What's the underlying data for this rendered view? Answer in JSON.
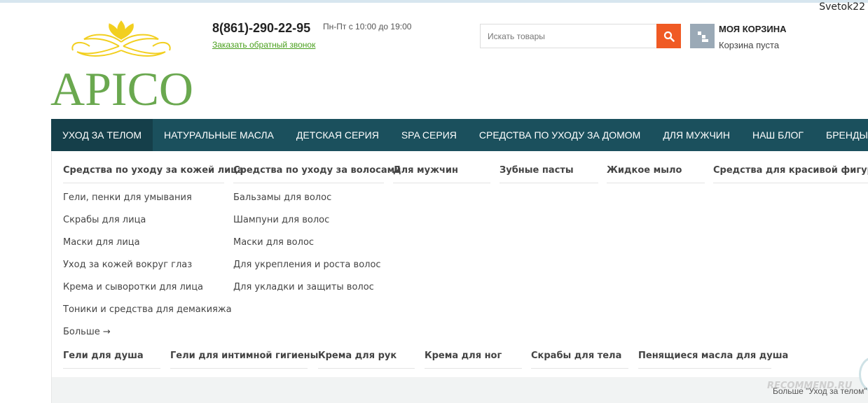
{
  "user": {
    "name": "Svetok22"
  },
  "logo": {
    "text": "APICO"
  },
  "contact": {
    "phone": "8(861)-290-22-95",
    "hours": "Пн-Пт с 10:00 до 19:00",
    "callback": "Заказать обратный звонок"
  },
  "search": {
    "placeholder": "Искать товары",
    "value": ""
  },
  "cart": {
    "title": "МОЯ КОРЗИНА",
    "status": "Корзина пуста"
  },
  "nav": [
    "УХОД ЗА ТЕЛОМ",
    "НАТУРАЛЬНЫЕ МАСЛА",
    "ДЕТСКАЯ СЕРИЯ",
    "SPA СЕРИЯ",
    "СРЕДСТВА ПО УХОДУ ЗА ДОМОМ",
    "ДЛЯ МУЖЧИН",
    "НАШ БЛОГ",
    "БРЕНДЫ"
  ],
  "mega": {
    "row1": [
      "Средства по уходу за кожей лица",
      "Средства по уходу за волосами",
      "Для мужчин",
      "Зубные пасты",
      "Жидкое мыло",
      "Средства для красивой фигуры."
    ],
    "face_items": [
      "Гели, пенки для умывания",
      "Скрабы для лица",
      "Маски для лица",
      "Уход за кожей вокруг глаз",
      "Крема и сыворотки для лица",
      "Тоники и средства для демакияжа",
      "Больше →"
    ],
    "hair_items": [
      "Бальзамы для волос",
      "Шампуни для волос",
      "Маски для волос",
      "Для укрепления и роста волос",
      "Для укладки и защиты волос"
    ],
    "row2": [
      "Гели для душа",
      "Гели для интимной гигиены",
      "Крема для рук",
      "Крема для ног",
      "Скрабы для тела",
      "Пенящиеся масла для душа"
    ]
  },
  "footer": {
    "overflow": "Больше \"Уход за телом\""
  },
  "watermark": {
    "text": "RECOMMEND.RU"
  },
  "colors": {
    "nav_bg": "#1b505d",
    "nav_active": "#153f4a",
    "search_button": "#f05a24",
    "link_green": "#4aa01e",
    "logo_green": "#6aa84f",
    "logo_gold": "#f2cf1f"
  },
  "icons": {
    "search": "search-icon",
    "cart": "cart-icon",
    "logo": "lotus-icon"
  }
}
